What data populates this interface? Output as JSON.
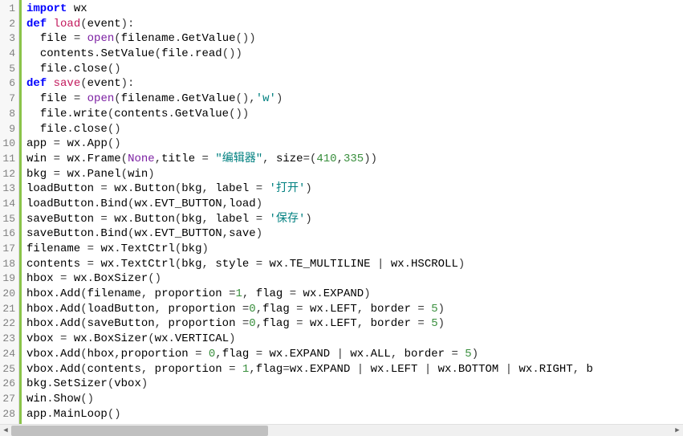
{
  "lineCount": 28,
  "code": {
    "tokens": [
      [
        [
          "kw",
          "import"
        ],
        [
          "sp",
          " "
        ],
        [
          "id",
          "wx"
        ]
      ],
      [
        [
          "kw",
          "def"
        ],
        [
          "sp",
          " "
        ],
        [
          "fn",
          "load"
        ],
        [
          "op",
          "("
        ],
        [
          "id",
          "event"
        ],
        [
          "op",
          "):"
        ]
      ],
      [
        [
          "sp",
          "  "
        ],
        [
          "id",
          "file"
        ],
        [
          "sp",
          " "
        ],
        [
          "op",
          "="
        ],
        [
          "sp",
          " "
        ],
        [
          "builtin",
          "open"
        ],
        [
          "op",
          "("
        ],
        [
          "id",
          "filename"
        ],
        [
          "op",
          "."
        ],
        [
          "id",
          "GetValue"
        ],
        [
          "op",
          "())"
        ]
      ],
      [
        [
          "sp",
          "  "
        ],
        [
          "id",
          "contents"
        ],
        [
          "op",
          "."
        ],
        [
          "id",
          "SetValue"
        ],
        [
          "op",
          "("
        ],
        [
          "id",
          "file"
        ],
        [
          "op",
          "."
        ],
        [
          "id",
          "read"
        ],
        [
          "op",
          "())"
        ]
      ],
      [
        [
          "sp",
          "  "
        ],
        [
          "id",
          "file"
        ],
        [
          "op",
          "."
        ],
        [
          "id",
          "close"
        ],
        [
          "op",
          "()"
        ]
      ],
      [
        [
          "kw",
          "def"
        ],
        [
          "sp",
          " "
        ],
        [
          "fn",
          "save"
        ],
        [
          "op",
          "("
        ],
        [
          "id",
          "event"
        ],
        [
          "op",
          "):"
        ]
      ],
      [
        [
          "sp",
          "  "
        ],
        [
          "id",
          "file"
        ],
        [
          "sp",
          " "
        ],
        [
          "op",
          "="
        ],
        [
          "sp",
          " "
        ],
        [
          "builtin",
          "open"
        ],
        [
          "op",
          "("
        ],
        [
          "id",
          "filename"
        ],
        [
          "op",
          "."
        ],
        [
          "id",
          "GetValue"
        ],
        [
          "op",
          "(),"
        ],
        [
          "str",
          "'w'"
        ],
        [
          "op",
          ")"
        ]
      ],
      [
        [
          "sp",
          "  "
        ],
        [
          "id",
          "file"
        ],
        [
          "op",
          "."
        ],
        [
          "id",
          "write"
        ],
        [
          "op",
          "("
        ],
        [
          "id",
          "contents"
        ],
        [
          "op",
          "."
        ],
        [
          "id",
          "GetValue"
        ],
        [
          "op",
          "())"
        ]
      ],
      [
        [
          "sp",
          "  "
        ],
        [
          "id",
          "file"
        ],
        [
          "op",
          "."
        ],
        [
          "id",
          "close"
        ],
        [
          "op",
          "()"
        ]
      ],
      [
        [
          "id",
          "app"
        ],
        [
          "sp",
          " "
        ],
        [
          "op",
          "="
        ],
        [
          "sp",
          " "
        ],
        [
          "id",
          "wx"
        ],
        [
          "op",
          "."
        ],
        [
          "id",
          "App"
        ],
        [
          "op",
          "()"
        ]
      ],
      [
        [
          "id",
          "win"
        ],
        [
          "sp",
          " "
        ],
        [
          "op",
          "="
        ],
        [
          "sp",
          " "
        ],
        [
          "id",
          "wx"
        ],
        [
          "op",
          "."
        ],
        [
          "id",
          "Frame"
        ],
        [
          "op",
          "("
        ],
        [
          "builtin",
          "None"
        ],
        [
          "op",
          ","
        ],
        [
          "id",
          "title"
        ],
        [
          "sp",
          " "
        ],
        [
          "op",
          "="
        ],
        [
          "sp",
          " "
        ],
        [
          "str",
          "\"编辑器\""
        ],
        [
          "op",
          ", "
        ],
        [
          "id",
          "size"
        ],
        [
          "op",
          "=("
        ],
        [
          "num",
          "410"
        ],
        [
          "op",
          ","
        ],
        [
          "num",
          "335"
        ],
        [
          "op",
          "))"
        ]
      ],
      [
        [
          "id",
          "bkg"
        ],
        [
          "sp",
          " "
        ],
        [
          "op",
          "="
        ],
        [
          "sp",
          " "
        ],
        [
          "id",
          "wx"
        ],
        [
          "op",
          "."
        ],
        [
          "id",
          "Panel"
        ],
        [
          "op",
          "("
        ],
        [
          "id",
          "win"
        ],
        [
          "op",
          ")"
        ]
      ],
      [
        [
          "id",
          "loadButton"
        ],
        [
          "sp",
          " "
        ],
        [
          "op",
          "="
        ],
        [
          "sp",
          " "
        ],
        [
          "id",
          "wx"
        ],
        [
          "op",
          "."
        ],
        [
          "id",
          "Button"
        ],
        [
          "op",
          "("
        ],
        [
          "id",
          "bkg"
        ],
        [
          "op",
          ", "
        ],
        [
          "id",
          "label"
        ],
        [
          "sp",
          " "
        ],
        [
          "op",
          "="
        ],
        [
          "sp",
          " "
        ],
        [
          "str",
          "'打开'"
        ],
        [
          "op",
          ")"
        ]
      ],
      [
        [
          "id",
          "loadButton"
        ],
        [
          "op",
          "."
        ],
        [
          "id",
          "Bind"
        ],
        [
          "op",
          "("
        ],
        [
          "id",
          "wx"
        ],
        [
          "op",
          "."
        ],
        [
          "id",
          "EVT_BUTTON"
        ],
        [
          "op",
          ","
        ],
        [
          "id",
          "load"
        ],
        [
          "op",
          ")"
        ]
      ],
      [
        [
          "id",
          "saveButton"
        ],
        [
          "sp",
          " "
        ],
        [
          "op",
          "="
        ],
        [
          "sp",
          " "
        ],
        [
          "id",
          "wx"
        ],
        [
          "op",
          "."
        ],
        [
          "id",
          "Button"
        ],
        [
          "op",
          "("
        ],
        [
          "id",
          "bkg"
        ],
        [
          "op",
          ", "
        ],
        [
          "id",
          "label"
        ],
        [
          "sp",
          " "
        ],
        [
          "op",
          "="
        ],
        [
          "sp",
          " "
        ],
        [
          "str",
          "'保存'"
        ],
        [
          "op",
          ")"
        ]
      ],
      [
        [
          "id",
          "saveButton"
        ],
        [
          "op",
          "."
        ],
        [
          "id",
          "Bind"
        ],
        [
          "op",
          "("
        ],
        [
          "id",
          "wx"
        ],
        [
          "op",
          "."
        ],
        [
          "id",
          "EVT_BUTTON"
        ],
        [
          "op",
          ","
        ],
        [
          "id",
          "save"
        ],
        [
          "op",
          ")"
        ]
      ],
      [
        [
          "id",
          "filename"
        ],
        [
          "sp",
          " "
        ],
        [
          "op",
          "="
        ],
        [
          "sp",
          " "
        ],
        [
          "id",
          "wx"
        ],
        [
          "op",
          "."
        ],
        [
          "id",
          "TextCtrl"
        ],
        [
          "op",
          "("
        ],
        [
          "id",
          "bkg"
        ],
        [
          "op",
          ")"
        ]
      ],
      [
        [
          "id",
          "contents"
        ],
        [
          "sp",
          " "
        ],
        [
          "op",
          "="
        ],
        [
          "sp",
          " "
        ],
        [
          "id",
          "wx"
        ],
        [
          "op",
          "."
        ],
        [
          "id",
          "TextCtrl"
        ],
        [
          "op",
          "("
        ],
        [
          "id",
          "bkg"
        ],
        [
          "op",
          ", "
        ],
        [
          "id",
          "style"
        ],
        [
          "sp",
          " "
        ],
        [
          "op",
          "="
        ],
        [
          "sp",
          " "
        ],
        [
          "id",
          "wx"
        ],
        [
          "op",
          "."
        ],
        [
          "id",
          "TE_MULTILINE"
        ],
        [
          "sp",
          " "
        ],
        [
          "op",
          "|"
        ],
        [
          "sp",
          " "
        ],
        [
          "id",
          "wx"
        ],
        [
          "op",
          "."
        ],
        [
          "id",
          "HSCROLL"
        ],
        [
          "op",
          ")"
        ]
      ],
      [
        [
          "id",
          "hbox"
        ],
        [
          "sp",
          " "
        ],
        [
          "op",
          "="
        ],
        [
          "sp",
          " "
        ],
        [
          "id",
          "wx"
        ],
        [
          "op",
          "."
        ],
        [
          "id",
          "BoxSizer"
        ],
        [
          "op",
          "()"
        ]
      ],
      [
        [
          "id",
          "hbox"
        ],
        [
          "op",
          "."
        ],
        [
          "id",
          "Add"
        ],
        [
          "op",
          "("
        ],
        [
          "id",
          "filename"
        ],
        [
          "op",
          ", "
        ],
        [
          "id",
          "proportion"
        ],
        [
          "sp",
          " "
        ],
        [
          "op",
          "="
        ],
        [
          "num",
          "1"
        ],
        [
          "op",
          ", "
        ],
        [
          "id",
          "flag"
        ],
        [
          "sp",
          " "
        ],
        [
          "op",
          "="
        ],
        [
          "sp",
          " "
        ],
        [
          "id",
          "wx"
        ],
        [
          "op",
          "."
        ],
        [
          "id",
          "EXPAND"
        ],
        [
          "op",
          ")"
        ]
      ],
      [
        [
          "id",
          "hbox"
        ],
        [
          "op",
          "."
        ],
        [
          "id",
          "Add"
        ],
        [
          "op",
          "("
        ],
        [
          "id",
          "loadButton"
        ],
        [
          "op",
          ", "
        ],
        [
          "id",
          "proportion"
        ],
        [
          "sp",
          " "
        ],
        [
          "op",
          "="
        ],
        [
          "num",
          "0"
        ],
        [
          "op",
          ","
        ],
        [
          "id",
          "flag"
        ],
        [
          "sp",
          " "
        ],
        [
          "op",
          "="
        ],
        [
          "sp",
          " "
        ],
        [
          "id",
          "wx"
        ],
        [
          "op",
          "."
        ],
        [
          "id",
          "LEFT"
        ],
        [
          "op",
          ", "
        ],
        [
          "id",
          "border"
        ],
        [
          "sp",
          " "
        ],
        [
          "op",
          "="
        ],
        [
          "sp",
          " "
        ],
        [
          "num",
          "5"
        ],
        [
          "op",
          ")"
        ]
      ],
      [
        [
          "id",
          "hbox"
        ],
        [
          "op",
          "."
        ],
        [
          "id",
          "Add"
        ],
        [
          "op",
          "("
        ],
        [
          "id",
          "saveButton"
        ],
        [
          "op",
          ", "
        ],
        [
          "id",
          "proportion"
        ],
        [
          "sp",
          " "
        ],
        [
          "op",
          "="
        ],
        [
          "num",
          "0"
        ],
        [
          "op",
          ","
        ],
        [
          "id",
          "flag"
        ],
        [
          "sp",
          " "
        ],
        [
          "op",
          "="
        ],
        [
          "sp",
          " "
        ],
        [
          "id",
          "wx"
        ],
        [
          "op",
          "."
        ],
        [
          "id",
          "LEFT"
        ],
        [
          "op",
          ", "
        ],
        [
          "id",
          "border"
        ],
        [
          "sp",
          " "
        ],
        [
          "op",
          "="
        ],
        [
          "sp",
          " "
        ],
        [
          "num",
          "5"
        ],
        [
          "op",
          ")"
        ]
      ],
      [
        [
          "id",
          "vbox"
        ],
        [
          "sp",
          " "
        ],
        [
          "op",
          "="
        ],
        [
          "sp",
          " "
        ],
        [
          "id",
          "wx"
        ],
        [
          "op",
          "."
        ],
        [
          "id",
          "BoxSizer"
        ],
        [
          "op",
          "("
        ],
        [
          "id",
          "wx"
        ],
        [
          "op",
          "."
        ],
        [
          "id",
          "VERTICAL"
        ],
        [
          "op",
          ")"
        ]
      ],
      [
        [
          "id",
          "vbox"
        ],
        [
          "op",
          "."
        ],
        [
          "id",
          "Add"
        ],
        [
          "op",
          "("
        ],
        [
          "id",
          "hbox"
        ],
        [
          "op",
          ","
        ],
        [
          "id",
          "proportion"
        ],
        [
          "sp",
          " "
        ],
        [
          "op",
          "="
        ],
        [
          "sp",
          " "
        ],
        [
          "num",
          "0"
        ],
        [
          "op",
          ","
        ],
        [
          "id",
          "flag"
        ],
        [
          "sp",
          " "
        ],
        [
          "op",
          "="
        ],
        [
          "sp",
          " "
        ],
        [
          "id",
          "wx"
        ],
        [
          "op",
          "."
        ],
        [
          "id",
          "EXPAND"
        ],
        [
          "sp",
          " "
        ],
        [
          "op",
          "|"
        ],
        [
          "sp",
          " "
        ],
        [
          "id",
          "wx"
        ],
        [
          "op",
          "."
        ],
        [
          "id",
          "ALL"
        ],
        [
          "op",
          ", "
        ],
        [
          "id",
          "border"
        ],
        [
          "sp",
          " "
        ],
        [
          "op",
          "="
        ],
        [
          "sp",
          " "
        ],
        [
          "num",
          "5"
        ],
        [
          "op",
          ")"
        ]
      ],
      [
        [
          "id",
          "vbox"
        ],
        [
          "op",
          "."
        ],
        [
          "id",
          "Add"
        ],
        [
          "op",
          "("
        ],
        [
          "id",
          "contents"
        ],
        [
          "op",
          ", "
        ],
        [
          "id",
          "proportion"
        ],
        [
          "sp",
          " "
        ],
        [
          "op",
          "="
        ],
        [
          "sp",
          " "
        ],
        [
          "num",
          "1"
        ],
        [
          "op",
          ","
        ],
        [
          "id",
          "flag"
        ],
        [
          "op",
          "="
        ],
        [
          "id",
          "wx"
        ],
        [
          "op",
          "."
        ],
        [
          "id",
          "EXPAND"
        ],
        [
          "sp",
          " "
        ],
        [
          "op",
          "|"
        ],
        [
          "sp",
          " "
        ],
        [
          "id",
          "wx"
        ],
        [
          "op",
          "."
        ],
        [
          "id",
          "LEFT"
        ],
        [
          "sp",
          " "
        ],
        [
          "op",
          "|"
        ],
        [
          "sp",
          " "
        ],
        [
          "id",
          "wx"
        ],
        [
          "op",
          "."
        ],
        [
          "id",
          "BOTTOM"
        ],
        [
          "sp",
          " "
        ],
        [
          "op",
          "|"
        ],
        [
          "sp",
          " "
        ],
        [
          "id",
          "wx"
        ],
        [
          "op",
          "."
        ],
        [
          "id",
          "RIGHT"
        ],
        [
          "op",
          ", "
        ],
        [
          "id",
          "b"
        ]
      ],
      [
        [
          "id",
          "bkg"
        ],
        [
          "op",
          "."
        ],
        [
          "id",
          "SetSizer"
        ],
        [
          "op",
          "("
        ],
        [
          "id",
          "vbox"
        ],
        [
          "op",
          ")"
        ]
      ],
      [
        [
          "id",
          "win"
        ],
        [
          "op",
          "."
        ],
        [
          "id",
          "Show"
        ],
        [
          "op",
          "()"
        ]
      ],
      [
        [
          "id",
          "app"
        ],
        [
          "op",
          "."
        ],
        [
          "id",
          "MainLoop"
        ],
        [
          "op",
          "()"
        ]
      ]
    ]
  },
  "scrollbar": {
    "leftArrow": "◀",
    "rightArrow": "▶"
  }
}
